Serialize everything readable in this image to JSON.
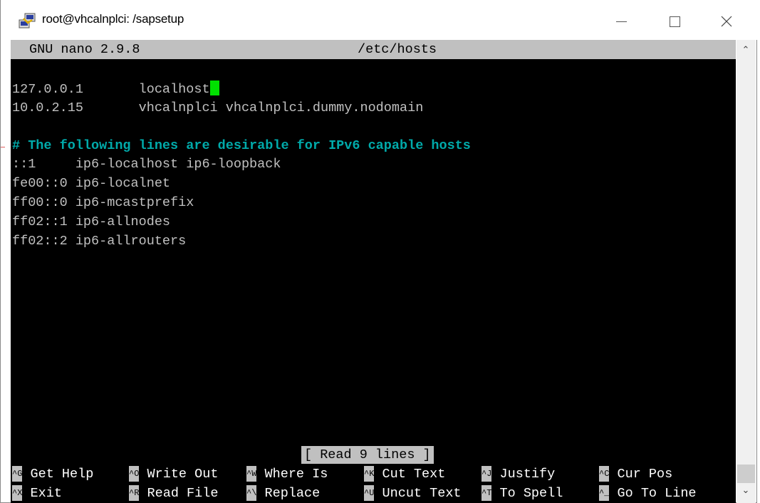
{
  "window": {
    "title": "root@vhcalnplci: /sapsetup",
    "icon": "putty-icon"
  },
  "nano": {
    "version": "GNU nano 2.9.8",
    "filename": "/etc/hosts",
    "lines": [
      "127.0.0.1       localhost",
      "10.0.2.15       vhcalnplci vhcalnplci.dummy.nodomain",
      "",
      "# The following lines are desirable for IPv6 capable hosts",
      "::1     ip6-localhost ip6-loopback",
      "fe00::0 ip6-localnet",
      "ff00::0 ip6-mcastprefix",
      "ff02::1 ip6-allnodes",
      "ff02::2 ip6-allrouters"
    ],
    "status": "[ Read 9 lines ]",
    "shortcuts_row1": [
      {
        "key": "^G",
        "label": "Get Help"
      },
      {
        "key": "^O",
        "label": "Write Out"
      },
      {
        "key": "^W",
        "label": "Where Is"
      },
      {
        "key": "^K",
        "label": "Cut Text"
      },
      {
        "key": "^J",
        "label": "Justify"
      },
      {
        "key": "^C",
        "label": "Cur Pos"
      }
    ],
    "shortcuts_row2": [
      {
        "key": "^X",
        "label": "Exit"
      },
      {
        "key": "^R",
        "label": "Read File"
      },
      {
        "key": "^\\",
        "label": "Replace"
      },
      {
        "key": "^U",
        "label": "Uncut Text"
      },
      {
        "key": "^T",
        "label": "To Spell"
      },
      {
        "key": "^_",
        "label": "Go To Line"
      }
    ]
  },
  "colors": {
    "terminal_bg": "#000000",
    "text": "#c0c0c0",
    "comment": "#00aaaa",
    "cursor": "#00e000",
    "header_bg": "#c0c0c0"
  }
}
